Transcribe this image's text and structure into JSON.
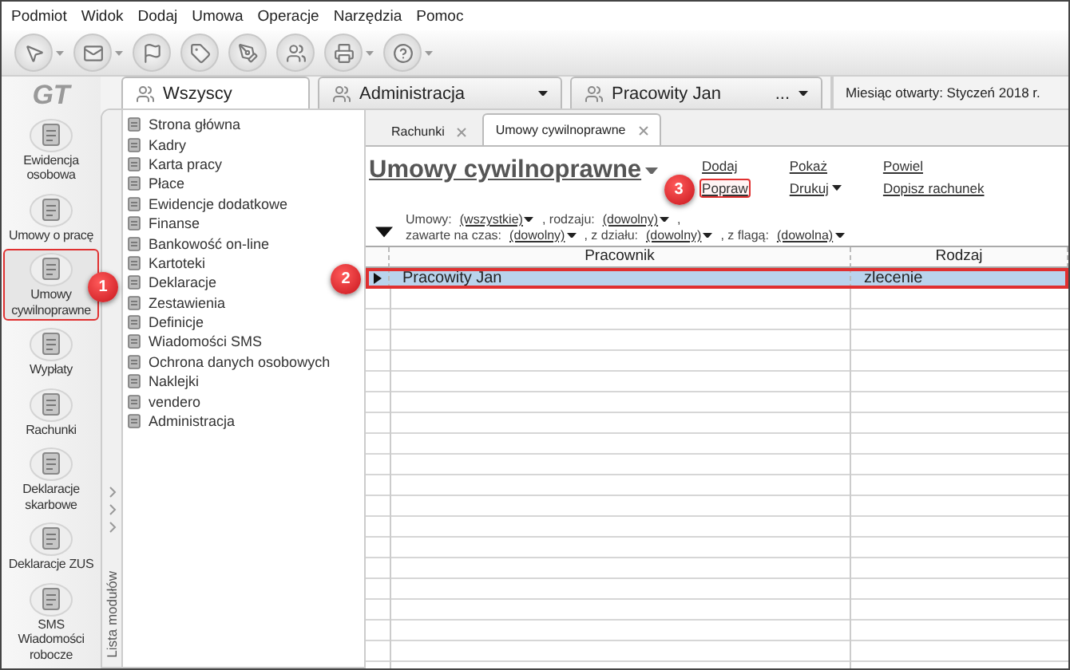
{
  "menu": [
    "Podmiot",
    "Widok",
    "Dodaj",
    "Umowa",
    "Operacje",
    "Narzędzia",
    "Pomoc"
  ],
  "toolbar": [
    {
      "dropdown": true
    },
    {
      "dropdown": true
    },
    {
      "dropdown": false
    },
    {
      "dropdown": false
    },
    {
      "dropdown": false
    },
    {
      "dropdown": false
    },
    {
      "dropdown": true
    },
    {
      "dropdown": true
    }
  ],
  "logo": "GT",
  "profile_tabs": [
    {
      "label": "Wszyscy",
      "selected": true,
      "kind": "group"
    },
    {
      "label": "Administracja",
      "selected": false,
      "kind": "group-dropdown"
    },
    {
      "label": "Pracowity Jan",
      "selected": false,
      "kind": "person",
      "extra": "..."
    }
  ],
  "month": "Miesiąc otwarty: Styczeń 2018 r.",
  "sidebar": [
    {
      "label": "Ewidencja osobowa",
      "selected": false,
      "highlighted": false
    },
    {
      "label": "Umowy o pracę",
      "selected": false,
      "highlighted": false
    },
    {
      "label": "Umowy cywilnoprawne",
      "selected": true,
      "highlighted": true,
      "callout": "1"
    },
    {
      "label": "Wypłaty",
      "selected": false,
      "highlighted": false
    },
    {
      "label": "Rachunki",
      "selected": false,
      "highlighted": false
    },
    {
      "label": "Deklaracje skarbowe",
      "selected": false,
      "highlighted": false
    },
    {
      "label": "Deklaracje ZUS",
      "selected": false,
      "highlighted": false
    },
    {
      "label": "SMS Wiadomości robocze",
      "selected": false,
      "highlighted": false
    }
  ],
  "modules_title": "Lista modułów",
  "modules": [
    "Strona główna",
    "Kadry",
    "Karta pracy",
    "Płace",
    "Ewidencje dodatkowe",
    "Finanse",
    "Bankowość on-line",
    "Kartoteki",
    "Deklaracje",
    "Zestawienia",
    "Definicje",
    "Wiadomości SMS",
    "Ochrona danych osobowych",
    "Naklejki",
    "vendero",
    "Administracja"
  ],
  "doc_tabs": [
    {
      "label": "Rachunki",
      "selected": false
    },
    {
      "label": "Umowy cywilnoprawne",
      "selected": true
    }
  ],
  "title": "Umowy cywilnoprawne",
  "actions": [
    {
      "label": "Dodaj",
      "dropdown": false,
      "highlighted": false
    },
    {
      "label": "Pokaż",
      "dropdown": false,
      "highlighted": false
    },
    {
      "label": "Powiel",
      "dropdown": false,
      "highlighted": false
    },
    {
      "label": "Popraw",
      "dropdown": false,
      "highlighted": true,
      "callout": "3"
    },
    {
      "label": "Drukuj",
      "dropdown": true,
      "highlighted": false
    },
    {
      "label": "Dopisz rachunek",
      "dropdown": false,
      "highlighted": false
    }
  ],
  "filters": [
    [
      {
        "kind": "label",
        "text": "Umowy:"
      },
      {
        "kind": "link",
        "text": "(wszystkie)"
      },
      {
        "kind": "label",
        "text": ", rodzaju:"
      },
      {
        "kind": "link",
        "text": "(dowolny)"
      },
      {
        "kind": "label",
        "text": ","
      }
    ],
    [
      {
        "kind": "label",
        "text": "zawarte na czas:"
      },
      {
        "kind": "link",
        "text": "(dowolny)"
      },
      {
        "kind": "label",
        "text": ", z działu:"
      },
      {
        "kind": "link",
        "text": "(dowolny)"
      },
      {
        "kind": "label",
        "text": ", z flagą:"
      },
      {
        "kind": "link",
        "text": "(dowolna)"
      }
    ]
  ],
  "table": {
    "columns": [
      "Pracownik",
      "Rodzaj"
    ],
    "rows": [
      {
        "cells": [
          "Pracowity Jan",
          "zlecenie"
        ],
        "selected": true,
        "highlighted": true,
        "callout": "2"
      }
    ]
  }
}
